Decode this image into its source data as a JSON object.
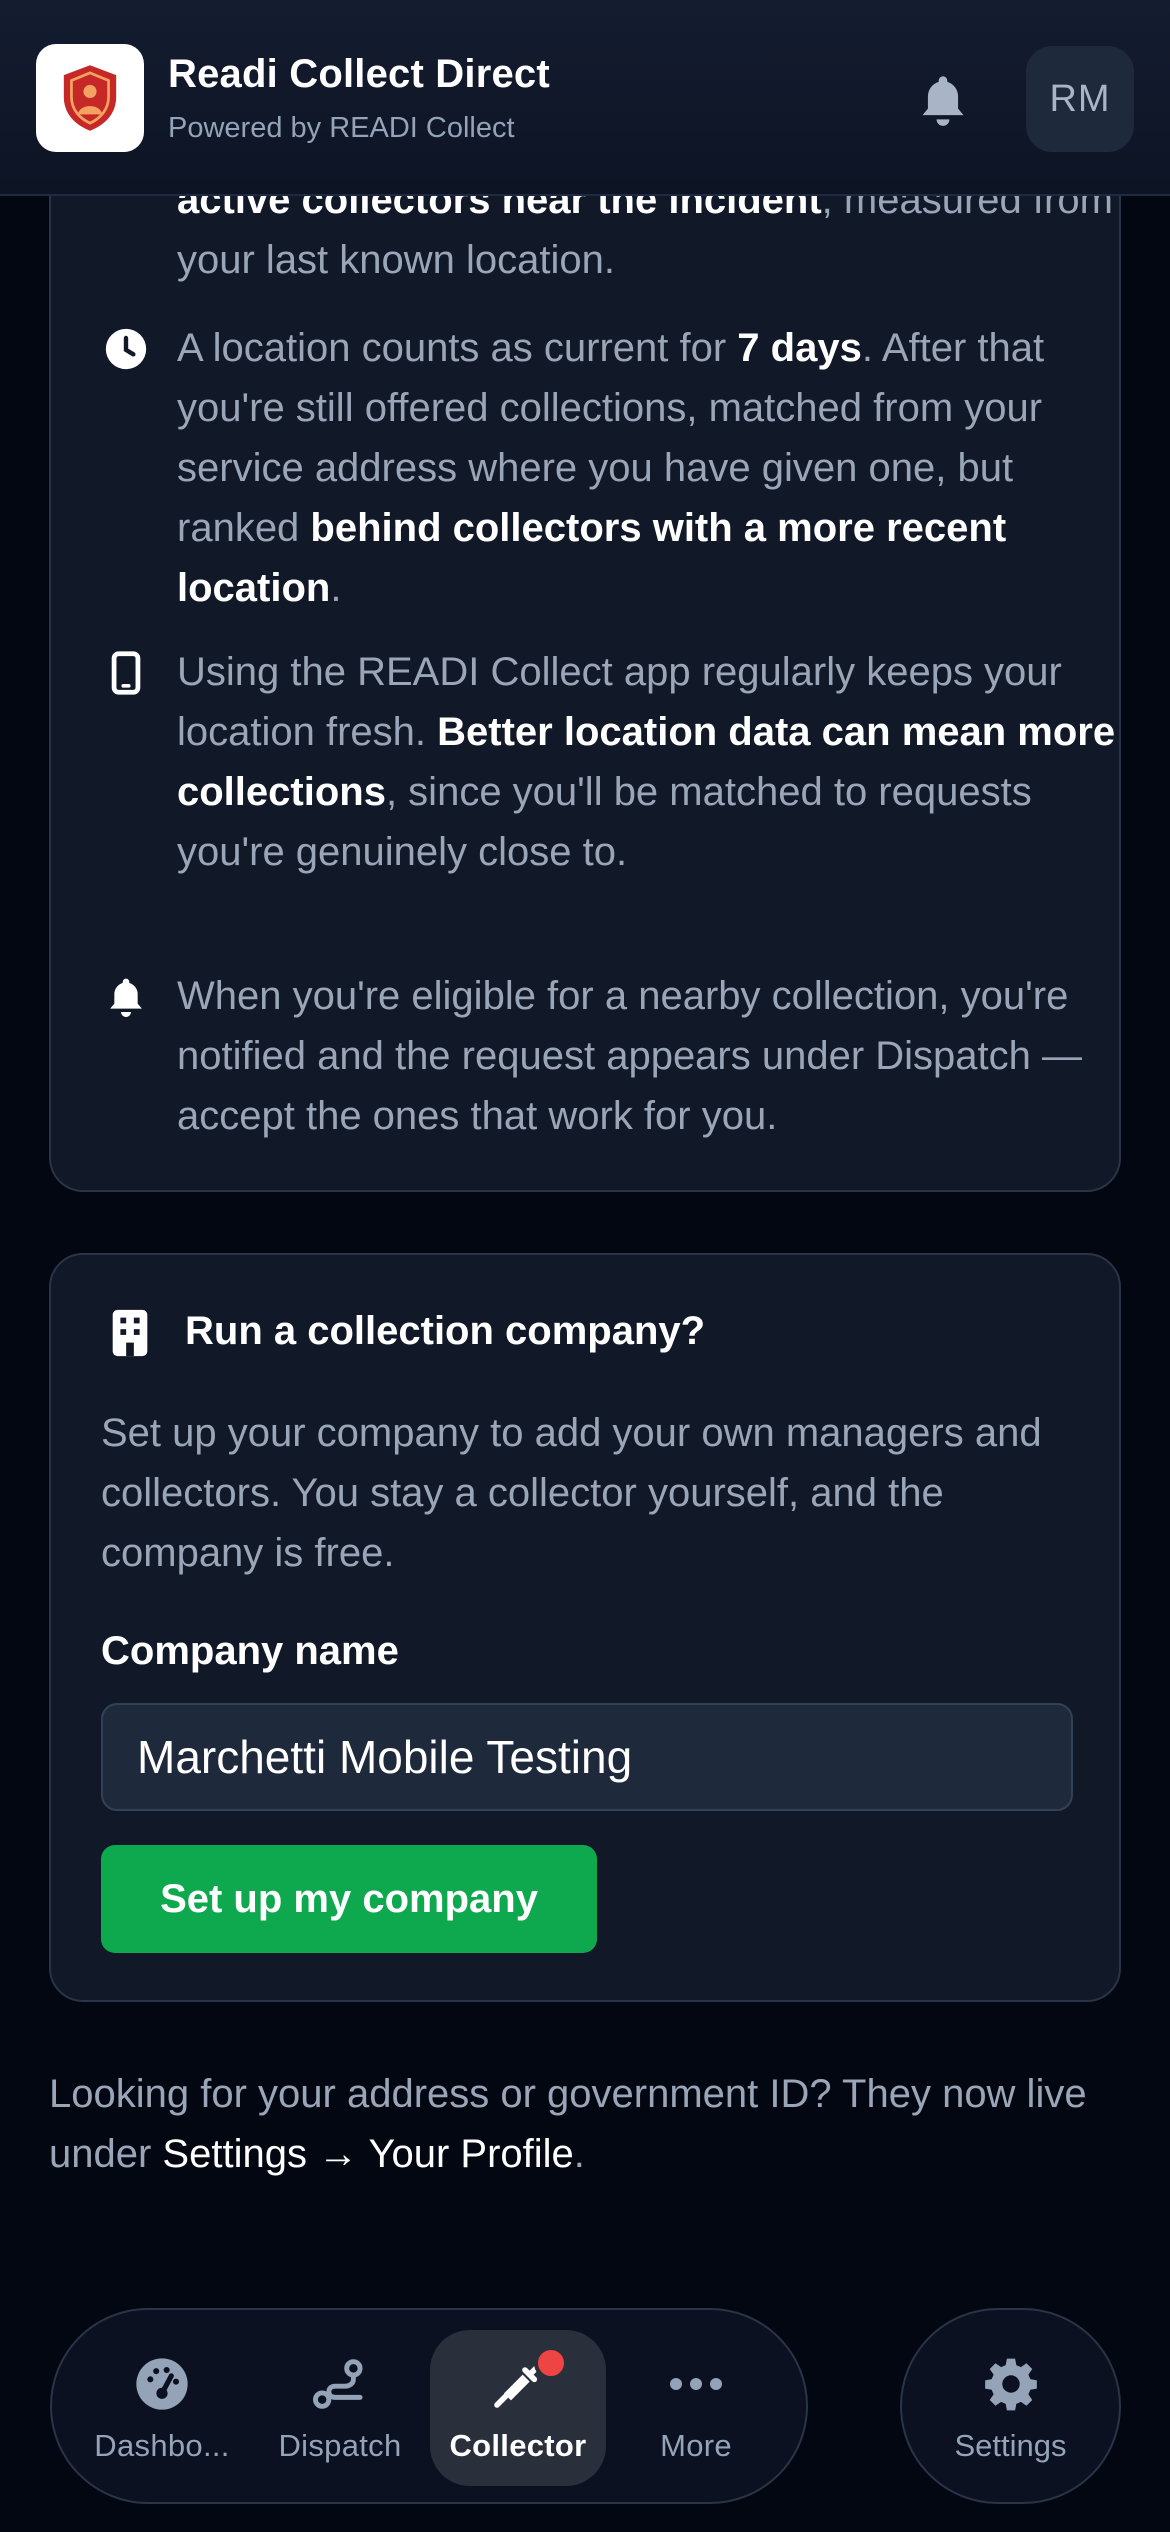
{
  "header": {
    "title": "Readi Collect Direct",
    "subtitle": "Powered by READI Collect",
    "avatar_initials": "RM"
  },
  "info": {
    "item0": {
      "text_bold": "active collectors near the incident",
      "text_after": ", measured from your last known location."
    },
    "item1": {
      "icon": "clock-icon",
      "t1": "A location counts as current for ",
      "b1": "7 days",
      "t2": ". After that you're still offered collections, matched from your service address where you have given one, but ranked ",
      "b2": "behind collectors with a more recent location",
      "t3": "."
    },
    "item2": {
      "icon": "phone-icon",
      "t1": "Using the READI Collect app regularly keeps your location fresh. ",
      "b1": "Better location data can mean more collections",
      "t2": ", since you'll be matched to requests you're genuinely close to."
    },
    "item3": {
      "icon": "bell-icon",
      "t1": "When you're eligible for a nearby collection, you're notified and the request appears under Dispatch — accept the ones that work for you."
    }
  },
  "company": {
    "title": "Run a collection company?",
    "description": "Set up your company to add your own managers and collectors. You stay a collector yourself, and the company is free.",
    "field_label": "Company name",
    "field_value": "Marchetti Mobile Testing",
    "button_label": "Set up my company"
  },
  "profile_note": {
    "t1": "Looking for your address or government ID? They now live under ",
    "link": "Settings → Your Profile",
    "t2": "."
  },
  "nav": {
    "items": [
      {
        "label": "Dashbo...",
        "icon": "gauge-icon"
      },
      {
        "label": "Dispatch",
        "icon": "route-icon"
      },
      {
        "label": "Collector",
        "icon": "syringe-icon"
      },
      {
        "label": "More",
        "icon": "more-dots-icon"
      }
    ],
    "active_index": 2,
    "settings_label": "Settings"
  },
  "colors": {
    "background": "#030712",
    "card": "#111827",
    "primary_button": "#0ea84f",
    "badge": "#ef4444",
    "muted_text": "#9aa6b8"
  }
}
